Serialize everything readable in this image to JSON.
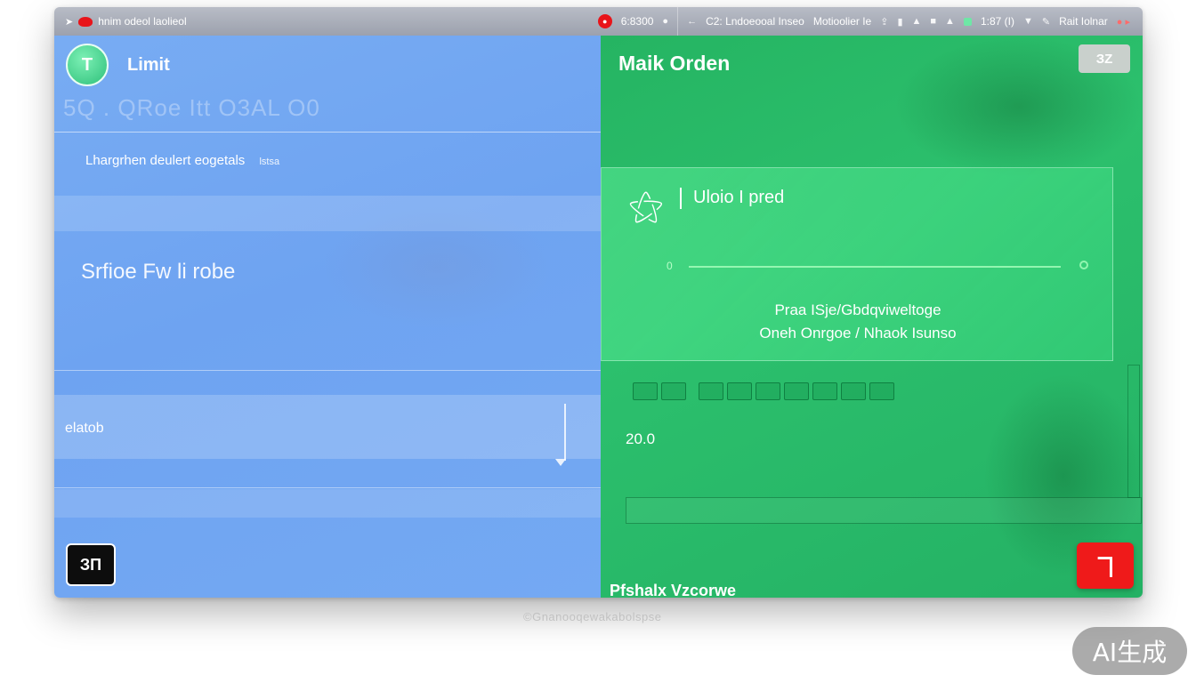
{
  "menubar": {
    "app_title": "hnim  odeol laolieol",
    "rec_badge": "6:8300",
    "status_text": "C2: Lndoeooal  Inseo",
    "menu_item": "Motioolier  Ie",
    "clock": "1:87 (I)",
    "right_label": "Rait  Iolnar"
  },
  "left": {
    "avatar_letter": "T",
    "title": "Limit",
    "ghost_row": "5Q   . QRoe  Itt O3AL O0",
    "subtitle": "Lhargrhen deulert eogetals",
    "subtitle_tag": "lstsa",
    "section_heading": "Srfioe  Fw li    robe",
    "field_label": "elatob",
    "action_button": "ЗП"
  },
  "right": {
    "title": "Maik Orden",
    "top_button": "ЗZ",
    "card": {
      "title": "Uloio I pred",
      "progress_start": "0",
      "progress": 0.0,
      "line1": "Praa  ISje/Gbdqviweltoge",
      "line2": "Oneh Onrgoe / Nhaok  Isunso"
    },
    "value": "20.0",
    "footer": "Pfshalx Vzcorwe",
    "red_button": "ヿ"
  },
  "caption": "©Gnanooqewakabolspse",
  "watermark": "AI生成",
  "colors": {
    "left_pane": "#72a8f2",
    "right_pane": "#2cc06d",
    "red_button": "#ef1a1a",
    "avatar": "#2ec07a"
  }
}
